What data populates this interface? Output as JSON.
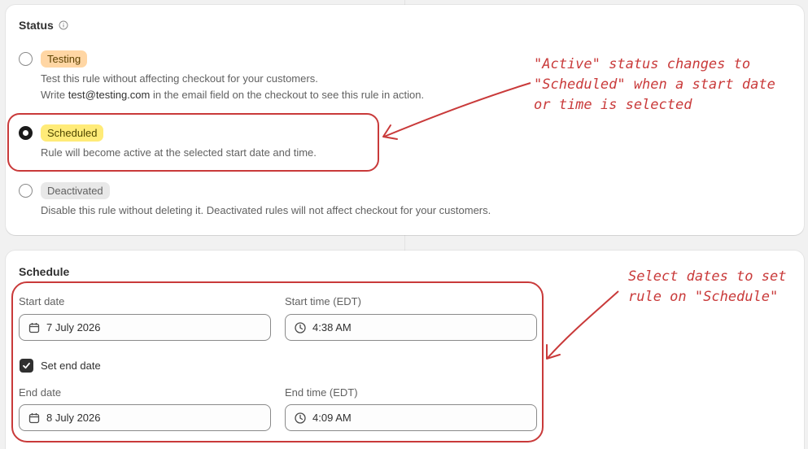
{
  "status": {
    "title": "Status",
    "options": [
      {
        "badge": "Testing",
        "desc_line1": "Test this rule without affecting checkout for your customers.",
        "desc_line2_pre": "Write ",
        "desc_line2_email": "test@testing.com",
        "desc_line2_post": " in the email field on the checkout to see this rule in action.",
        "selected": false
      },
      {
        "badge": "Scheduled",
        "desc_line1": "Rule will become active at the selected start date and time.",
        "selected": true
      },
      {
        "badge": "Deactivated",
        "desc_line1": "Disable this rule without deleting it. Deactivated rules will not affect checkout for your customers.",
        "selected": false
      }
    ]
  },
  "schedule": {
    "title": "Schedule",
    "start_date_label": "Start date",
    "start_date_value": "7 July 2026",
    "start_time_label": "Start time (EDT)",
    "start_time_value": "4:38 AM",
    "set_end_date_label": "Set end date",
    "set_end_date_checked": true,
    "end_date_label": "End date",
    "end_date_value": "8 July 2026",
    "end_time_label": "End time (EDT)",
    "end_time_value": "4:09 AM"
  },
  "annotations": {
    "note1": [
      "\"Active\" status changes to",
      "\"Scheduled\" when a start date",
      "or time is selected"
    ],
    "note2": [
      "Select dates to set",
      "rule on \"Schedule\""
    ],
    "color": "#c93a3a"
  },
  "icons": [
    "info-icon",
    "calendar-icon",
    "clock-icon",
    "checkmark-icon"
  ]
}
